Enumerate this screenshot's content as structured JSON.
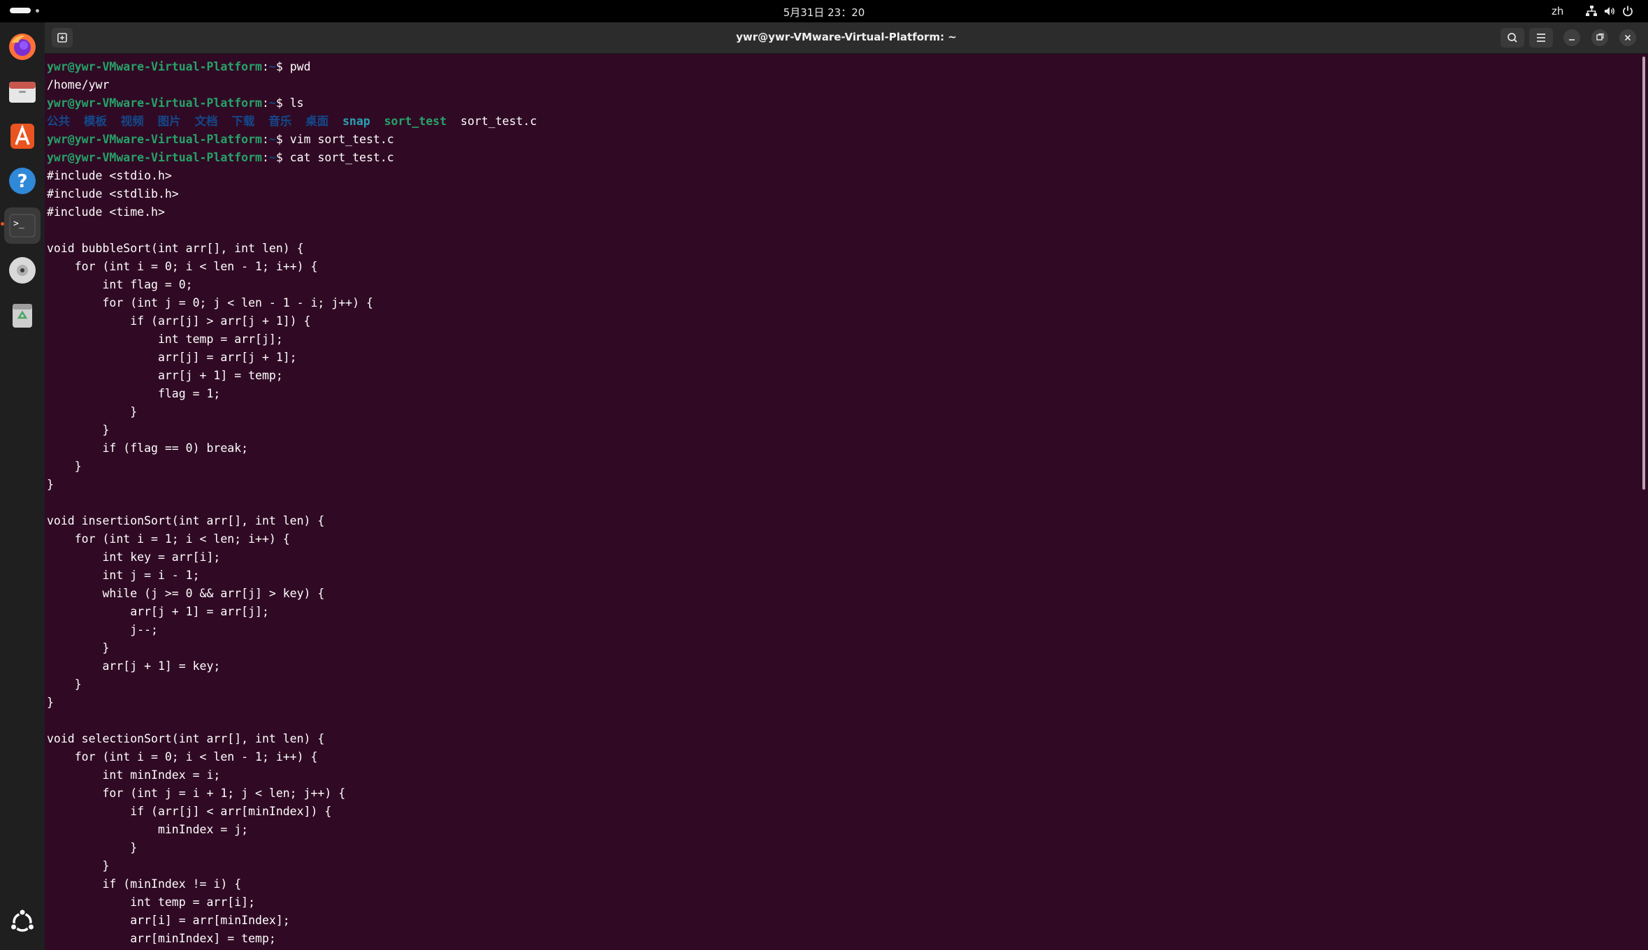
{
  "topbar": {
    "clock": "5月31日 23：20",
    "language": "zh"
  },
  "dock": {
    "items": [
      {
        "name": "firefox",
        "icon": "firefox-icon"
      },
      {
        "name": "files",
        "icon": "files-icon"
      },
      {
        "name": "app-center",
        "icon": "app-center-icon"
      },
      {
        "name": "help",
        "icon": "help-icon",
        "glyph": "?"
      },
      {
        "name": "terminal",
        "icon": "terminal-icon",
        "glyph": ">_"
      },
      {
        "name": "optical-disc",
        "icon": "disc-icon"
      },
      {
        "name": "trash",
        "icon": "trash-icon"
      },
      {
        "name": "show-apps",
        "icon": "ubuntu-logo-icon"
      }
    ]
  },
  "window": {
    "title": "ywr@ywr-VMware-Virtual-Platform: ~"
  },
  "colors": {
    "terminal_bg": "#300a24",
    "prompt_user": "#26a269",
    "prompt_path": "#12488b",
    "ls_dir": "#12488b",
    "ls_link": "#2aa1b3",
    "ls_exec": "#26a269",
    "dock_running": "#e95420"
  },
  "terminal": {
    "prompt_user": "ywr@ywr-VMware-Virtual-Platform",
    "prompt_path": "~",
    "sessions": [
      {
        "command": "pwd",
        "output": [
          "/home/ywr"
        ]
      },
      {
        "command": "ls",
        "ls_entries": [
          {
            "name": "公共",
            "kind": "dir"
          },
          {
            "name": "模板",
            "kind": "dir"
          },
          {
            "name": "视频",
            "kind": "dir"
          },
          {
            "name": "图片",
            "kind": "dir"
          },
          {
            "name": "文档",
            "kind": "dir"
          },
          {
            "name": "下载",
            "kind": "dir"
          },
          {
            "name": "音乐",
            "kind": "dir"
          },
          {
            "name": "桌面",
            "kind": "dir"
          },
          {
            "name": "snap",
            "kind": "link"
          },
          {
            "name": "sort_test",
            "kind": "exec"
          },
          {
            "name": "sort_test.c",
            "kind": "file"
          }
        ]
      },
      {
        "command": "vim sort_test.c",
        "output": []
      },
      {
        "command": "cat sort_test.c",
        "output": [
          "#include <stdio.h>",
          "#include <stdlib.h>",
          "#include <time.h>",
          "",
          "void bubbleSort(int arr[], int len) {",
          "    for (int i = 0; i < len - 1; i++) {",
          "        int flag = 0;",
          "        for (int j = 0; j < len - 1 - i; j++) {",
          "            if (arr[j] > arr[j + 1]) {",
          "                int temp = arr[j];",
          "                arr[j] = arr[j + 1];",
          "                arr[j + 1] = temp;",
          "                flag = 1;",
          "            }",
          "        }",
          "        if (flag == 0) break;",
          "    }",
          "}",
          "",
          "void insertionSort(int arr[], int len) {",
          "    for (int i = 1; i < len; i++) {",
          "        int key = arr[i];",
          "        int j = i - 1;",
          "        while (j >= 0 && arr[j] > key) {",
          "            arr[j + 1] = arr[j];",
          "            j--;",
          "        }",
          "        arr[j + 1] = key;",
          "    }",
          "}",
          "",
          "void selectionSort(int arr[], int len) {",
          "    for (int i = 0; i < len - 1; i++) {",
          "        int minIndex = i;",
          "        for (int j = i + 1; j < len; j++) {",
          "            if (arr[j] < arr[minIndex]) {",
          "                minIndex = j;",
          "            }",
          "        }",
          "        if (minIndex != i) {",
          "            int temp = arr[i];",
          "            arr[i] = arr[minIndex];",
          "            arr[minIndex] = temp;"
        ]
      }
    ]
  }
}
